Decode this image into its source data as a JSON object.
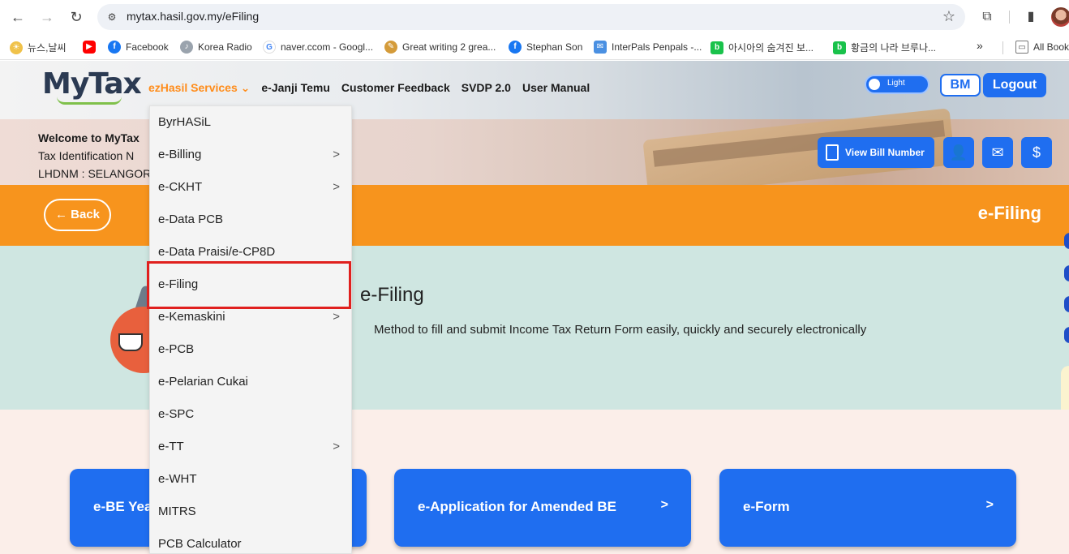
{
  "browser": {
    "url": "mytax.hasil.gov.my/eFiling",
    "bookmarks": [
      "뉴스,날씨",
      "Facebook",
      "Korea Radio",
      "naver.ccom - Googl...",
      "Great writing 2 grea...",
      "Stephan Son",
      "InterPals Penpals -...",
      "아시아의 숨겨진 보...",
      "황금의 나라 브루나..."
    ],
    "all_bookmarks": "All Bookmarks"
  },
  "header": {
    "logo_text": "MyTax",
    "nav": [
      "ezHasil Services",
      "e-Janji Temu",
      "Customer Feedback",
      "SVDP 2.0",
      "User Manual"
    ],
    "theme_toggle": "Light",
    "lang_button": "BM",
    "logout_button": "Logout"
  },
  "welcome": {
    "line1": "Welcome to MyTax",
    "line2": "Tax Identification N",
    "line3": "LHDNM : SELANGOR"
  },
  "actions": {
    "view_bill": "View Bill Number"
  },
  "banner": {
    "back": "Back",
    "title": "e-Filing"
  },
  "info": {
    "title": "e-Filing",
    "description": "Method to fill and submit Income Tax Return Form easily, quickly and securely electronically"
  },
  "tiles": [
    "e-BE Yea",
    "e-Application for Amended BE",
    "e-Form"
  ],
  "tile_chevron": ">",
  "dropdown": {
    "items": [
      {
        "label": "ByrHASiL",
        "sub": false
      },
      {
        "label": "e-Billing",
        "sub": true
      },
      {
        "label": "e-CKHT",
        "sub": true
      },
      {
        "label": "e-Data PCB",
        "sub": false
      },
      {
        "label": "e-Data Praisi/e-CP8D",
        "sub": false
      },
      {
        "label": "e-Filing",
        "sub": false
      },
      {
        "label": "e-Kemaskini",
        "sub": true
      },
      {
        "label": "e-PCB",
        "sub": false
      },
      {
        "label": "e-Pelarian Cukai",
        "sub": false
      },
      {
        "label": "e-SPC",
        "sub": false
      },
      {
        "label": "e-TT",
        "sub": true
      },
      {
        "label": "e-WHT",
        "sub": false
      },
      {
        "label": "MITRS",
        "sub": false
      },
      {
        "label": "PCB Calculator",
        "sub": false
      }
    ],
    "chevron": ">"
  }
}
